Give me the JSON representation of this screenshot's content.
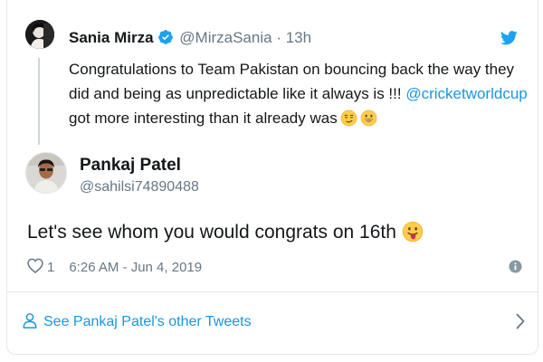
{
  "quoted_tweet": {
    "author_name": "Sania Mirza",
    "handle": "@MirzaSania",
    "separator": "·",
    "time": "13h",
    "text_line1": "Congratulations to Team Pakistan on bouncing back the way they",
    "text_line2_prefix": "did and being as unpredictable like it always is !!! ",
    "text_link": "@cricketworldcup",
    "text_line3": "got more interesting than it already was",
    "emojis": [
      "smirk-face-icon",
      "grinning-face-icon"
    ]
  },
  "tweet": {
    "author_name": "Pankaj Patel",
    "handle": "@sahilsi74890488",
    "text": "Let's see whom you would congrats on 16th",
    "emoji": "tongue-out-face-icon",
    "like_count": "1",
    "timestamp": "6:26 AM - Jun 4, 2019"
  },
  "footer": {
    "see_more_label": "See Pankaj Patel's other Tweets"
  },
  "colors": {
    "brand_blue": "#1da1f2",
    "link_blue": "#1b95e0",
    "secondary_text": "#657786",
    "primary_text": "#14171a",
    "border": "#e1e8ed"
  }
}
